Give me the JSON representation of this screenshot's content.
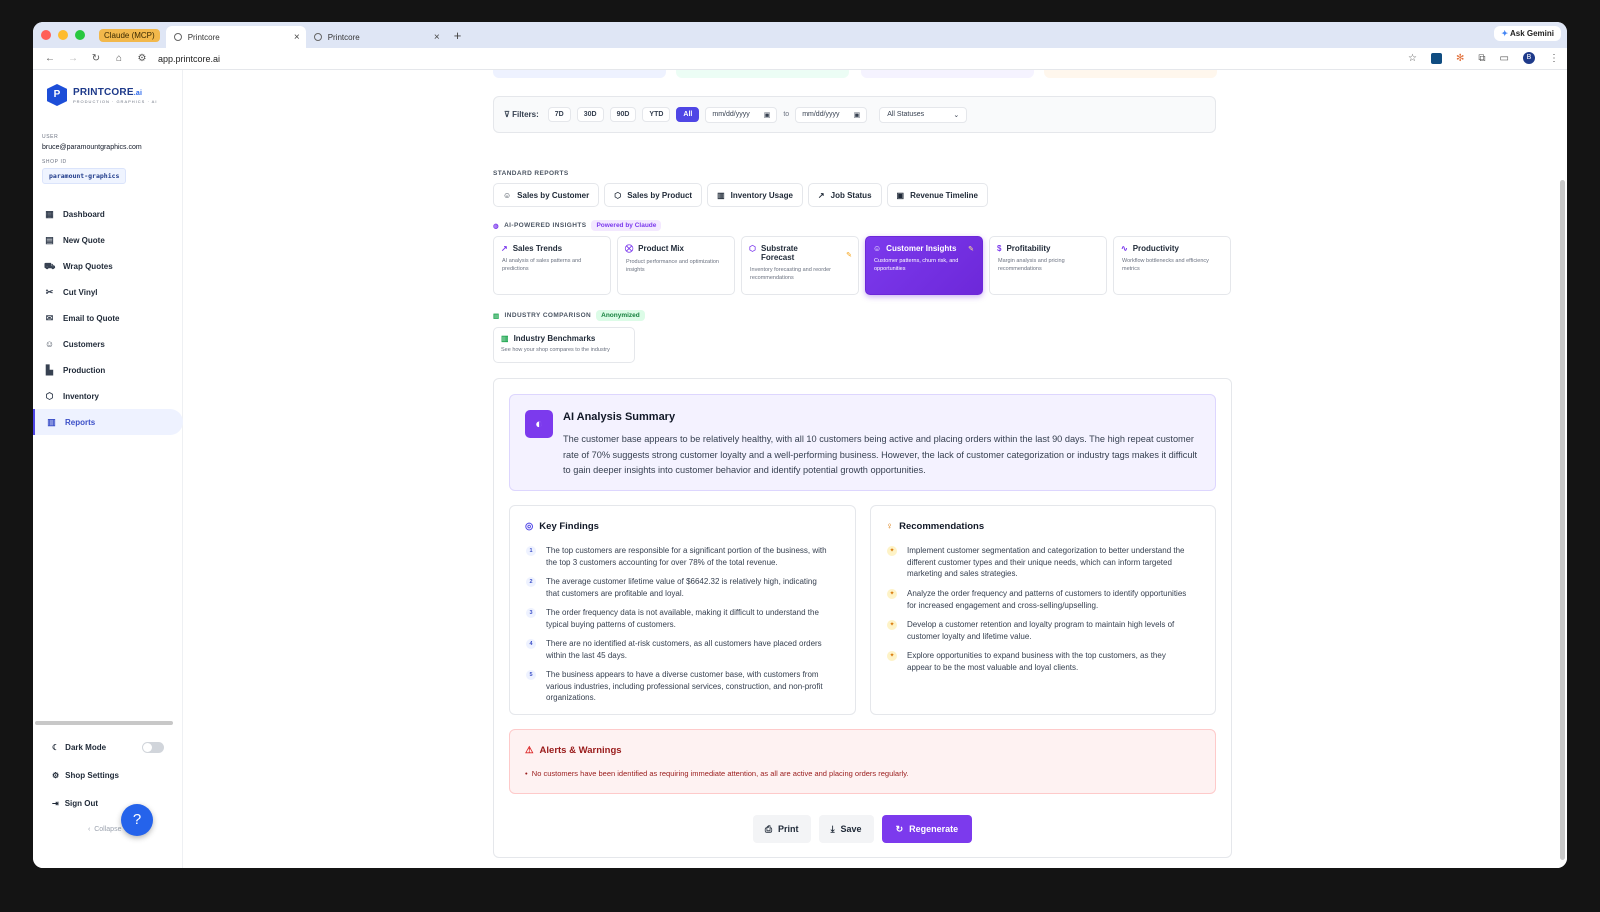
{
  "browser": {
    "tab_group": "Claude (MCP)",
    "tabs": [
      {
        "title": "Printcore",
        "active": true
      },
      {
        "title": "Printcore",
        "active": false
      }
    ],
    "url": "app.printcore.ai",
    "ask_gemini": "Ask Gemini",
    "profile_initial": "B"
  },
  "brand": {
    "name": "PRINTCORE",
    "suffix": ".ai",
    "tagline": "PRODUCTION · GRAPHICS · AI"
  },
  "user": {
    "label": "USER",
    "email": "bruce@paramountgraphics.com",
    "shop_label": "SHOP ID",
    "shop_id": "paramount-graphics"
  },
  "nav": [
    {
      "label": "Dashboard",
      "icon": "grid-icon"
    },
    {
      "label": "New Quote",
      "icon": "document-icon"
    },
    {
      "label": "Wrap Quotes",
      "icon": "car-icon"
    },
    {
      "label": "Cut Vinyl",
      "icon": "scissors-icon"
    },
    {
      "label": "Email to Quote",
      "icon": "mail-icon"
    },
    {
      "label": "Customers",
      "icon": "users-icon"
    },
    {
      "label": "Production",
      "icon": "factory-icon"
    },
    {
      "label": "Inventory",
      "icon": "box-icon"
    },
    {
      "label": "Reports",
      "icon": "bar-chart-icon",
      "active": true
    }
  ],
  "bottom_nav": {
    "dark_mode": "Dark Mode",
    "shop_settings": "Shop Settings",
    "sign_out": "Sign Out",
    "collapse": "Collapse"
  },
  "filters": {
    "label": "Filters:",
    "ranges": [
      "7D",
      "30D",
      "90D",
      "YTD",
      "All"
    ],
    "active_range": "All",
    "date_from": "mm/dd/yyyy",
    "date_to": "mm/dd/yyyy",
    "to_label": "to",
    "status": "All Statuses"
  },
  "standard_reports": {
    "heading": "STANDARD REPORTS",
    "items": [
      "Sales by Customer",
      "Sales by Product",
      "Inventory Usage",
      "Job Status",
      "Revenue Timeline"
    ]
  },
  "ai_insights": {
    "heading": "AI-POWERED INSIGHTS",
    "badge": "Powered by Claude",
    "cards": [
      {
        "title": "Sales Trends",
        "desc": "AI analysis of sales patterns and predictions"
      },
      {
        "title": "Product Mix",
        "desc": "Product performance and optimization insights"
      },
      {
        "title": "Substrate Forecast",
        "desc": "Inventory forecasting and reorder recommendations"
      },
      {
        "title": "Customer Insights",
        "desc": "Customer patterns, churn risk, and opportunities",
        "selected": true
      },
      {
        "title": "Profitability",
        "desc": "Margin analysis and pricing recommendations"
      },
      {
        "title": "Productivity",
        "desc": "Workflow bottlenecks and efficiency metrics"
      }
    ]
  },
  "industry": {
    "heading": "INDUSTRY COMPARISON",
    "badge": "Anonymized",
    "card_title": "Industry Benchmarks",
    "card_desc": "See how your shop compares to the industry"
  },
  "summary": {
    "title": "AI Analysis Summary",
    "text": "The customer base appears to be relatively healthy, with all 10 customers being active and placing orders within the last 90 days. The high repeat customer rate of 70% suggests strong customer loyalty and a well-performing business. However, the lack of customer categorization or industry tags makes it difficult to gain deeper insights into customer behavior and identify potential growth opportunities."
  },
  "findings": {
    "title": "Key Findings",
    "items": [
      "The top customers are responsible for a significant portion of the business, with the top 3 customers accounting for over 78% of the total revenue.",
      "The average customer lifetime value of $6642.32 is relatively high, indicating that customers are profitable and loyal.",
      "The order frequency data is not available, making it difficult to understand the typical buying patterns of customers.",
      "There are no identified at-risk customers, as all customers have placed orders within the last 45 days.",
      "The business appears to have a diverse customer base, with customers from various industries, including professional services, construction, and non-profit organizations."
    ]
  },
  "recommendations": {
    "title": "Recommendations",
    "items": [
      "Implement customer segmentation and categorization to better understand the different customer types and their unique needs, which can inform targeted marketing and sales strategies.",
      "Analyze the order frequency and patterns of customers to identify opportunities for increased engagement and cross-selling/upselling.",
      "Develop a customer retention and loyalty program to maintain high levels of customer loyalty and lifetime value.",
      "Explore opportunities to expand business with the top customers, as they appear to be the most valuable and loyal clients."
    ]
  },
  "alerts": {
    "title": "Alerts & Warnings",
    "items": [
      "No customers have been identified as requiring immediate attention, as all are active and placing orders regularly."
    ]
  },
  "actions": {
    "print": "Print",
    "save": "Save",
    "regenerate": "Regenerate"
  },
  "colors": {
    "accent": "#7c3aed",
    "primary": "#4f46e5",
    "alert": "#991b1b"
  }
}
